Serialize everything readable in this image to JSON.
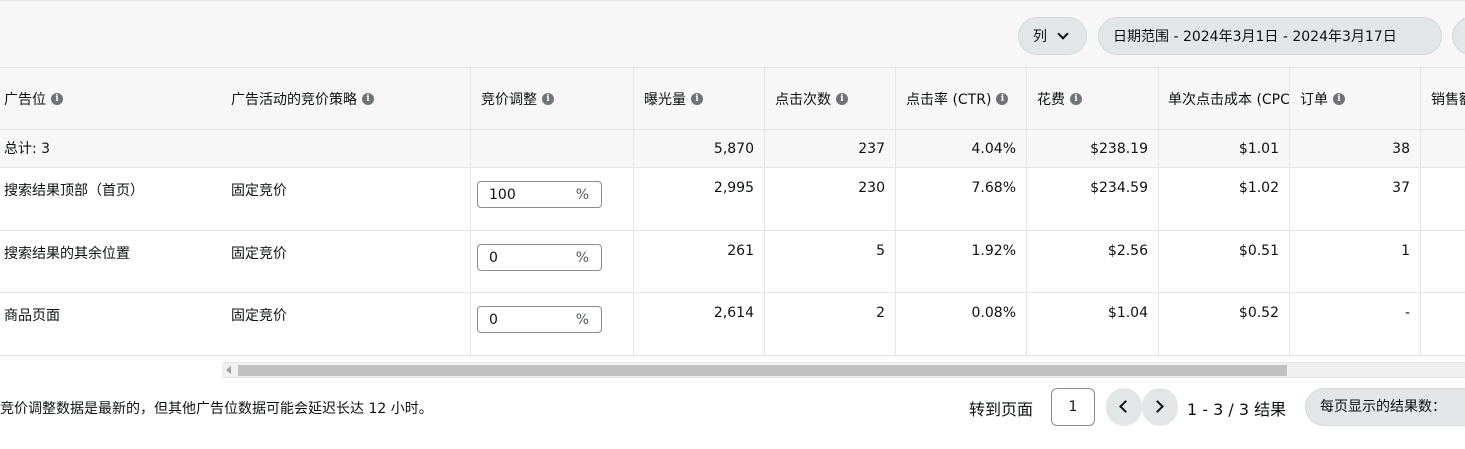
{
  "toolbar": {
    "columns_label": "列",
    "date_range_label": "日期范围 - 2024年3月1日 - 2024年3月17日"
  },
  "table": {
    "headers": [
      "广告位",
      "广告活动的竞价策略",
      "竞价调整",
      "曝光量",
      "点击次数",
      "点击率 (CTR)",
      "花费",
      "单次点击成本 (CPC)",
      "订单",
      "销售额"
    ],
    "totals": {
      "label": "总计: 3",
      "impressions": "5,870",
      "clicks": "237",
      "ctr": "4.04%",
      "spend": "$238.19",
      "cpc": "$1.01",
      "orders": "38"
    },
    "rows": [
      {
        "placement": "搜索结果顶部（首页）",
        "strategy": "固定竞价",
        "bid_adjust": "100",
        "impressions": "2,995",
        "clicks": "230",
        "ctr": "7.68%",
        "spend": "$234.59",
        "cpc": "$1.02",
        "orders": "37"
      },
      {
        "placement": "搜索结果的其余位置",
        "strategy": "固定竞价",
        "bid_adjust": "0",
        "impressions": "261",
        "clicks": "5",
        "ctr": "1.92%",
        "spend": "$2.56",
        "cpc": "$0.51",
        "orders": "1"
      },
      {
        "placement": "商品页面",
        "strategy": "固定竞价",
        "bid_adjust": "0",
        "impressions": "2,614",
        "clicks": "2",
        "ctr": "0.08%",
        "spend": "$1.04",
        "cpc": "$0.52",
        "orders": "-"
      }
    ],
    "percent_symbol": "%"
  },
  "footer": {
    "note": "竞价调整数据是最新的，但其他广告位数据可能会延迟长达 12 小时。",
    "goto_label": "转到页面",
    "page_value": "1",
    "results_text": "1 - 3 / 3 结果",
    "per_page_label": "每页显示的结果数："
  }
}
